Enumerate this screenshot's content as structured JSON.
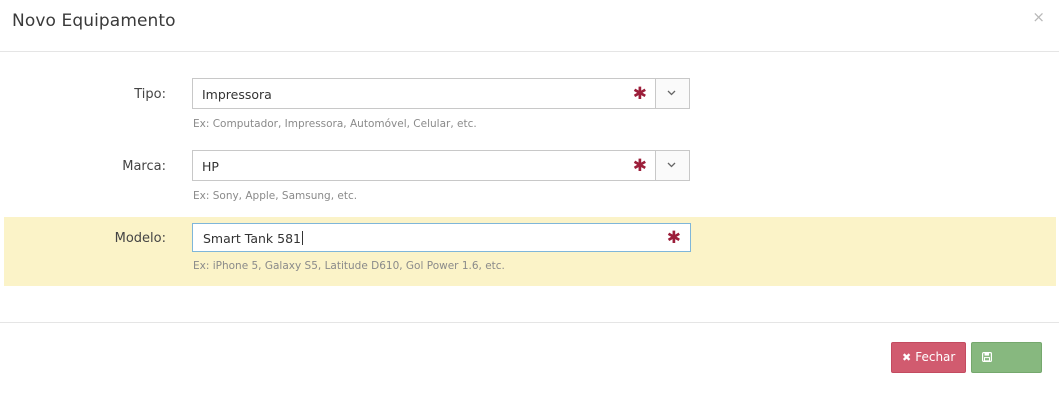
{
  "modal": {
    "title": "Novo Equipamento",
    "close_symbol": "×"
  },
  "form": {
    "tipo": {
      "label": "Tipo:",
      "value": "Impressora",
      "required_mark": "✱",
      "help": "Ex: Computador, Impressora, Automóvel, Celular, etc."
    },
    "marca": {
      "label": "Marca:",
      "value": "HP",
      "required_mark": "✱",
      "help": "Ex: Sony, Apple, Samsung, etc."
    },
    "modelo": {
      "label": "Modelo:",
      "value": "Smart Tank 581",
      "required_mark": "✱",
      "help": "Ex: iPhone 5, Galaxy S5, Latitude D610, Gol Power 1.6, etc."
    }
  },
  "footer": {
    "fechar_label": "Fechar",
    "salvar_label": "Salvar"
  },
  "colors": {
    "required": "#9c1e3a",
    "highlight_row": "#fbf3c8",
    "fechar": "#d15b6f",
    "salvar": "#87b87f"
  },
  "icons": {
    "close": "times-icon",
    "dropdown": "chevron-down-icon",
    "fechar": "times-icon",
    "salvar": "floppy-disk-icon"
  }
}
